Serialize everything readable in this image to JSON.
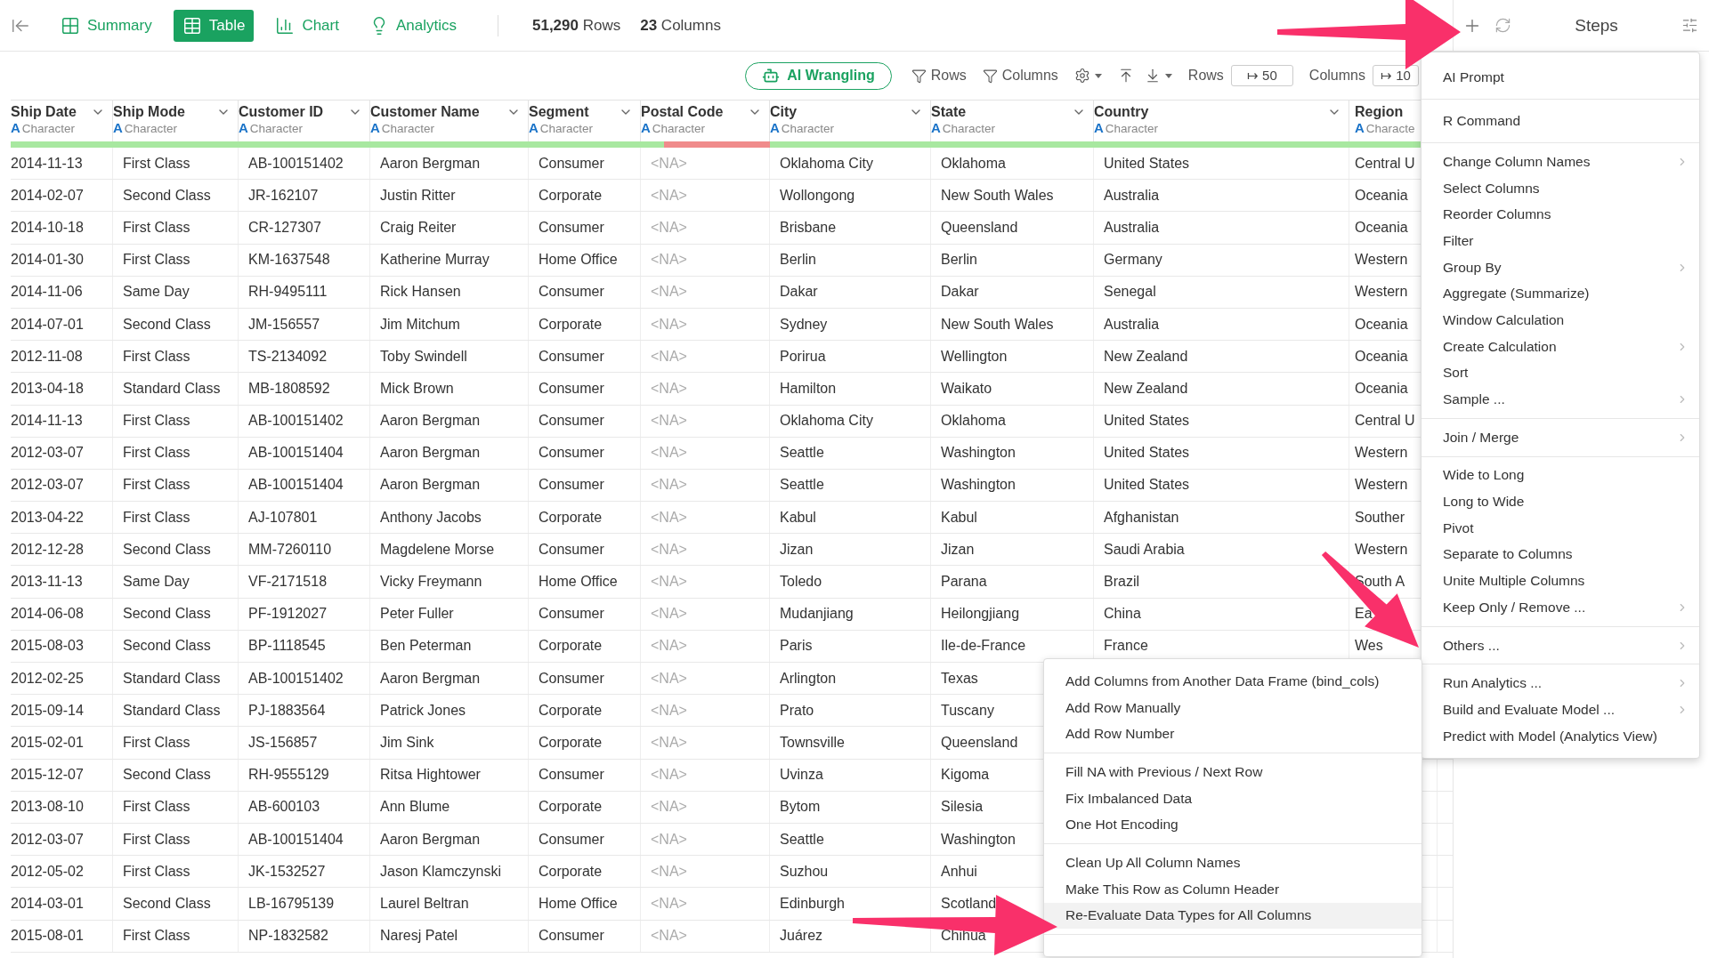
{
  "views": [
    {
      "label": "Summary",
      "selected": false
    },
    {
      "label": "Table",
      "selected": true
    },
    {
      "label": "Chart",
      "selected": false
    },
    {
      "label": "Analytics",
      "selected": false
    }
  ],
  "counts": [
    "**51,290** Rows",
    "**23** Columns"
  ],
  "toolbar": {
    "ai_button": "AI Wrangling",
    "filters": [
      "Rows",
      "Columns"
    ],
    "rows_label": "Rows",
    "rows_input": "↦ 50",
    "columns_label": "Columns",
    "columns_input": "↦ 10"
  },
  "columns": [
    {
      "name": "Ship Date",
      "type_icon": "A",
      "type": "Character",
      "level": 1
    },
    {
      "name": "Ship Mode",
      "type_icon": "A",
      "type": "Character",
      "level": 1
    },
    {
      "name": "Customer ID",
      "type_icon": "A",
      "type": "Character",
      "level": 1
    },
    {
      "name": "Customer Name",
      "type_icon": "A",
      "type": "Character",
      "level": 1
    },
    {
      "name": "Segment",
      "type_icon": "A",
      "type": "Character",
      "level": 1
    },
    {
      "name": "Postal Code",
      "type_icon": "A",
      "type": "Character",
      "level": 0.18
    },
    {
      "name": "City",
      "type_icon": "A",
      "type": "Character",
      "level": 1
    },
    {
      "name": "State",
      "type_icon": "A",
      "type": "Character",
      "level": 1
    },
    {
      "name": "Country",
      "type_icon": "A",
      "type": "Character",
      "level": 1
    },
    {
      "name": "Region",
      "type_icon": "A",
      "type": "Characte",
      "level": 1
    }
  ],
  "rows": [
    [
      "2014-11-13",
      "First Class",
      "AB-100151402",
      "Aaron Bergman",
      "Consumer",
      {
        "text": "<NA>",
        "missing": true
      },
      "Oklahoma City",
      "Oklahoma",
      "United States",
      "Central U"
    ],
    [
      "2014-02-07",
      "Second Class",
      "JR-162107",
      "Justin Ritter",
      "Corporate",
      {
        "text": "<NA>",
        "missing": true
      },
      "Wollongong",
      "New South Wales",
      "Australia",
      "Oceania"
    ],
    [
      "2014-10-18",
      "First Class",
      "CR-127307",
      "Craig Reiter",
      "Consumer",
      {
        "text": "<NA>",
        "missing": true
      },
      "Brisbane",
      "Queensland",
      "Australia",
      "Oceania"
    ],
    [
      "2014-01-30",
      "First Class",
      "KM-1637548",
      "Katherine Murray",
      "Home Office",
      {
        "text": "<NA>",
        "missing": true
      },
      "Berlin",
      "Berlin",
      "Germany",
      "Western"
    ],
    [
      "2014-11-06",
      "Same Day",
      "RH-9495111",
      "Rick Hansen",
      "Consumer",
      {
        "text": "<NA>",
        "missing": true
      },
      "Dakar",
      "Dakar",
      "Senegal",
      "Western"
    ],
    [
      "2014-07-01",
      "Second Class",
      "JM-156557",
      "Jim Mitchum",
      "Corporate",
      {
        "text": "<NA>",
        "missing": true
      },
      "Sydney",
      "New South Wales",
      "Australia",
      "Oceania"
    ],
    [
      "2012-11-08",
      "First Class",
      "TS-2134092",
      "Toby Swindell",
      "Consumer",
      {
        "text": "<NA>",
        "missing": true
      },
      "Porirua",
      "Wellington",
      "New Zealand",
      "Oceania"
    ],
    [
      "2013-04-18",
      "Standard Class",
      "MB-1808592",
      "Mick Brown",
      "Consumer",
      {
        "text": "<NA>",
        "missing": true
      },
      "Hamilton",
      "Waikato",
      "New Zealand",
      "Oceania"
    ],
    [
      "2014-11-13",
      "First Class",
      "AB-100151402",
      "Aaron Bergman",
      "Consumer",
      {
        "text": "<NA>",
        "missing": true
      },
      "Oklahoma City",
      "Oklahoma",
      "United States",
      "Central U"
    ],
    [
      "2012-03-07",
      "First Class",
      "AB-100151404",
      "Aaron Bergman",
      "Consumer",
      {
        "text": "<NA>",
        "missing": true
      },
      "Seattle",
      "Washington",
      "United States",
      "Western"
    ],
    [
      "2012-03-07",
      "First Class",
      "AB-100151404",
      "Aaron Bergman",
      "Consumer",
      {
        "text": "<NA>",
        "missing": true
      },
      "Seattle",
      "Washington",
      "United States",
      "Western"
    ],
    [
      "2013-04-22",
      "First Class",
      "AJ-107801",
      "Anthony Jacobs",
      "Corporate",
      {
        "text": "<NA>",
        "missing": true
      },
      "Kabul",
      "Kabul",
      "Afghanistan",
      "Souther"
    ],
    [
      "2012-12-28",
      "Second Class",
      "MM-7260110",
      "Magdelene Morse",
      "Consumer",
      {
        "text": "<NA>",
        "missing": true
      },
      "Jizan",
      "Jizan",
      "Saudi Arabia",
      "Western"
    ],
    [
      "2013-11-13",
      "Same Day",
      "VF-2171518",
      "Vicky Freymann",
      "Home Office",
      {
        "text": "<NA>",
        "missing": true
      },
      "Toledo",
      "Parana",
      "Brazil",
      "South A"
    ],
    [
      "2014-06-08",
      "Second Class",
      "PF-1912027",
      "Peter Fuller",
      "Consumer",
      {
        "text": "<NA>",
        "missing": true
      },
      "Mudanjiang",
      "Heilongjiang",
      "China",
      "Ea"
    ],
    [
      "2015-08-03",
      "Second Class",
      "BP-1118545",
      "Ben Peterman",
      "Corporate",
      {
        "text": "<NA>",
        "missing": true
      },
      "Paris",
      "Ile-de-France",
      "France",
      "Wes"
    ],
    [
      "2012-02-25",
      "Standard Class",
      "AB-100151402",
      "Aaron Bergman",
      "Consumer",
      {
        "text": "<NA>",
        "missing": true
      },
      "Arlington",
      "Texas",
      null,
      null
    ],
    [
      "2015-09-14",
      "Standard Class",
      "PJ-1883564",
      "Patrick Jones",
      "Corporate",
      {
        "text": "<NA>",
        "missing": true
      },
      "Prato",
      "Tuscany",
      null,
      null
    ],
    [
      "2015-02-01",
      "First Class",
      "JS-156857",
      "Jim Sink",
      "Corporate",
      {
        "text": "<NA>",
        "missing": true
      },
      "Townsville",
      "Queensland",
      null,
      null
    ],
    [
      "2015-12-07",
      "Second Class",
      "RH-9555129",
      "Ritsa Hightower",
      "Consumer",
      {
        "text": "<NA>",
        "missing": true
      },
      "Uvinza",
      "Kigoma",
      null,
      null
    ],
    [
      "2013-08-10",
      "First Class",
      "AB-600103",
      "Ann Blume",
      "Corporate",
      {
        "text": "<NA>",
        "missing": true
      },
      "Bytom",
      "Silesia",
      null,
      null
    ],
    [
      "2012-03-07",
      "First Class",
      "AB-100151404",
      "Aaron Bergman",
      "Consumer",
      {
        "text": "<NA>",
        "missing": true
      },
      "Seattle",
      "Washington",
      null,
      null
    ],
    [
      "2012-05-02",
      "First Class",
      "JK-1532527",
      "Jason Klamczynski",
      "Corporate",
      {
        "text": "<NA>",
        "missing": true
      },
      "Suzhou",
      "Anhui",
      null,
      null
    ],
    [
      "2014-03-01",
      "Second Class",
      "LB-16795139",
      "Laurel Beltran",
      "Home Office",
      {
        "text": "<NA>",
        "missing": true
      },
      "Edinburgh",
      "Scotland",
      null,
      null
    ],
    [
      "2015-08-01",
      "First Class",
      "NP-1832582",
      "Naresj Patel",
      "Consumer",
      {
        "text": "<NA>",
        "missing": true
      },
      "Juárez",
      "Chihua",
      null,
      null
    ]
  ],
  "steps": {
    "title": "Steps"
  },
  "menu": [
    [
      {
        "label": "AI Prompt",
        "has_submenu": false
      }
    ],
    [
      {
        "label": "R Command",
        "has_submenu": false
      }
    ],
    [
      {
        "label": "Change Column Names",
        "has_submenu": true
      },
      {
        "label": "Select Columns",
        "has_submenu": false
      },
      {
        "label": "Reorder Columns",
        "has_submenu": false
      },
      {
        "label": "Filter",
        "has_submenu": false
      },
      {
        "label": "Group By",
        "has_submenu": true
      },
      {
        "label": "Aggregate (Summarize)",
        "has_submenu": false
      },
      {
        "label": "Window Calculation",
        "has_submenu": false
      },
      {
        "label": "Create Calculation",
        "has_submenu": true
      },
      {
        "label": "Sort",
        "has_submenu": false
      },
      {
        "label": "Sample ...",
        "has_submenu": true
      }
    ],
    [
      {
        "label": "Join / Merge",
        "has_submenu": true
      }
    ],
    [
      {
        "label": "Wide to Long",
        "has_submenu": false
      },
      {
        "label": "Long to Wide",
        "has_submenu": false
      },
      {
        "label": "Pivot",
        "has_submenu": false
      },
      {
        "label": "Separate to Columns",
        "has_submenu": false
      },
      {
        "label": "Unite Multiple Columns",
        "has_submenu": false
      },
      {
        "label": "Keep Only / Remove ...",
        "has_submenu": true
      }
    ],
    [
      {
        "label": "Others ...",
        "has_submenu": true
      }
    ],
    [
      {
        "label": "Run Analytics ...",
        "has_submenu": true
      },
      {
        "label": "Build and Evaluate Model ...",
        "has_submenu": true
      },
      {
        "label": "Predict with Model (Analytics View)",
        "has_submenu": false
      }
    ]
  ],
  "submenu": [
    [
      {
        "label": "Add Columns from Another Data Frame (bind_cols)",
        "selected": false
      },
      {
        "label": "Add Row Manually",
        "selected": false
      },
      {
        "label": "Add Row Number",
        "selected": false
      }
    ],
    [
      {
        "label": "Fill NA with Previous / Next Row",
        "selected": false
      },
      {
        "label": "Fix Imbalanced Data",
        "selected": false
      },
      {
        "label": "One Hot Encoding",
        "selected": false
      }
    ],
    [
      {
        "label": "Clean Up All Column Names",
        "selected": false
      },
      {
        "label": "Make This Row as Column Header",
        "selected": false
      },
      {
        "label": "Re-Evaluate Data Types for All Columns",
        "selected": true
      }
    ]
  ]
}
